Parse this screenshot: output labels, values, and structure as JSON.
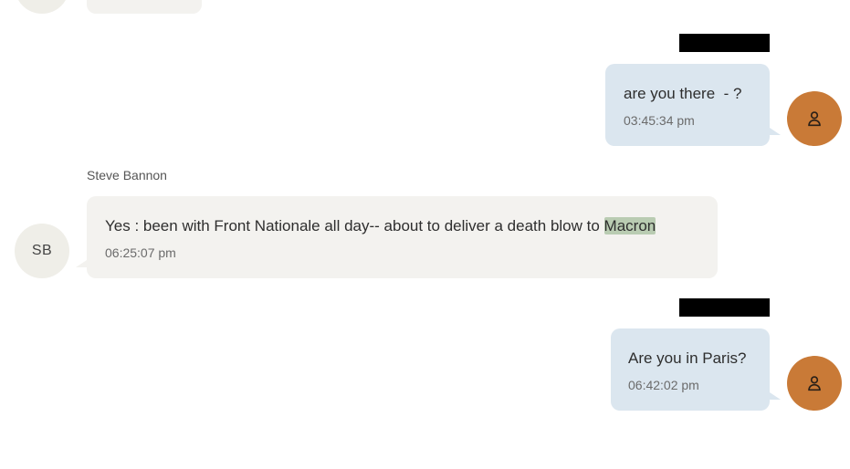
{
  "colors": {
    "incoming_bubble": "#f3f2ef",
    "outgoing_bubble": "#dbe6ef",
    "outgoing_avatar": "#c97a37",
    "incoming_avatar": "#efeee8",
    "highlight": "#b9ccb2"
  },
  "messages": [
    {
      "direction": "outgoing",
      "text": "are you there  - ?",
      "time": "03:45:34 pm",
      "avatar_icon": "user-icon"
    },
    {
      "direction": "incoming",
      "sender": "Steve Bannon",
      "avatar_initials": "SB",
      "text_before": "Yes : been with Front Nationale all day-- about to deliver a death blow to ",
      "text_highlight": "Macron",
      "time": "06:25:07 pm"
    },
    {
      "direction": "outgoing",
      "text": "Are you in Paris?",
      "time": "06:42:02 pm",
      "avatar_icon": "user-icon"
    }
  ]
}
